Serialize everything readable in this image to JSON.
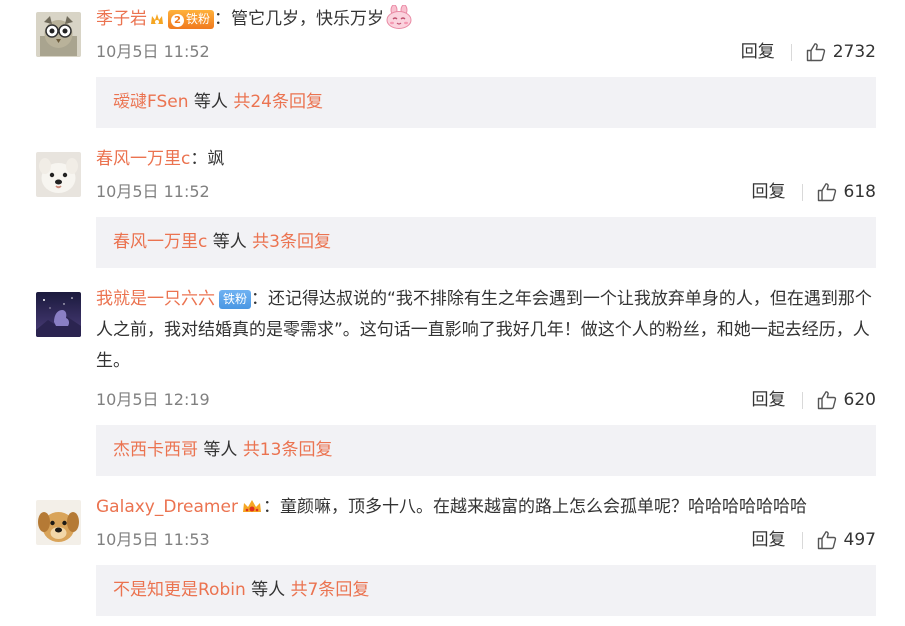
{
  "comments": [
    {
      "username": "季子岩",
      "badge": "铁粉",
      "text": "：管它几岁，快乐万岁",
      "emoji": "rabbit-face",
      "time": "10月5日 11:52",
      "reply_label": "回复",
      "likes": "2732",
      "replies": {
        "user": "叆叇FSen",
        "middle": " 等人 ",
        "count": "共24条回复"
      }
    },
    {
      "username": "春风一万里c",
      "text": "：飒",
      "time": "10月5日 11:52",
      "reply_label": "回复",
      "likes": "618",
      "replies": {
        "user": "春风一万里c",
        "middle": " 等人 ",
        "count": "共3条回复"
      }
    },
    {
      "username": "我就是一只六六",
      "badge": "铁粉",
      "text": "：还记得达叔说的“我不排除有生之年会遇到一个让我放弃单身的人，但在遇到那个人之前，我对结婚真的是零需求”。这句话一直影响了我好几年！做这个人的粉丝，和她一起去经历，人生。",
      "time": "10月5日 12:19",
      "reply_label": "回复",
      "likes": "620",
      "replies": {
        "user": "杰西卡西哥",
        "middle": " 等人 ",
        "count": "共13条回复"
      }
    },
    {
      "username": "Galaxy_Dreamer",
      "text": "：童颜嘛，顶多十八。在越来越富的路上怎么会孤单呢？哈哈哈哈哈哈哈",
      "time": "10月5日 11:53",
      "reply_label": "回复",
      "likes": "497",
      "replies": {
        "user": "不是知更是Robin",
        "middle": " 等人 ",
        "count": "共7条回复"
      }
    }
  ],
  "colors": {
    "username": "#eb7350",
    "meta": "#808080",
    "reply_box_bg": "#f2f2f5",
    "badge_blue": "#5aa3ec",
    "badge_orange": "#f59a2c"
  },
  "icons": {
    "like": "thumbs-up-icon",
    "vip": "vip-crown-icon",
    "emoji": "pink-rabbit-emoji"
  }
}
